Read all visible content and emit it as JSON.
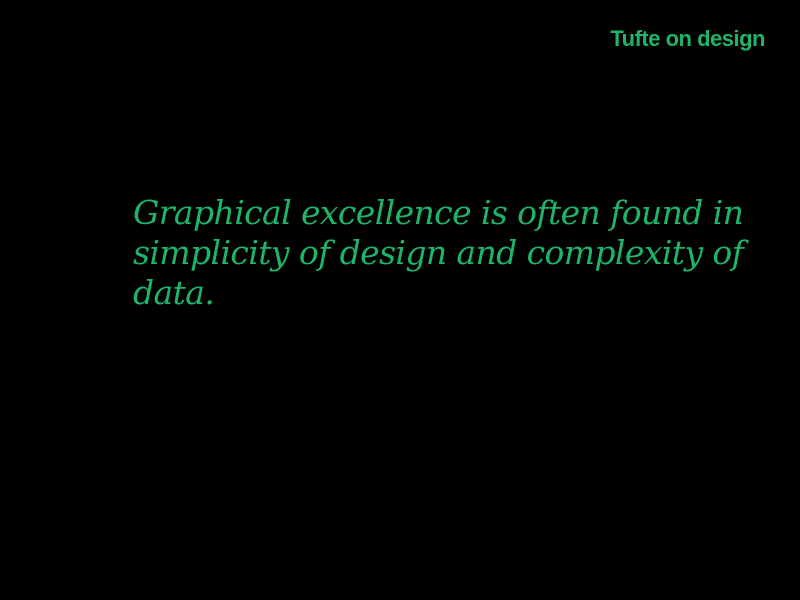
{
  "theme": {
    "background": "#000000",
    "accent": "#1db56a"
  },
  "header": {
    "brand": "Tufte on design"
  },
  "main": {
    "quote": "Graphical excellence is often found in simplicity of design and complexity of data."
  }
}
